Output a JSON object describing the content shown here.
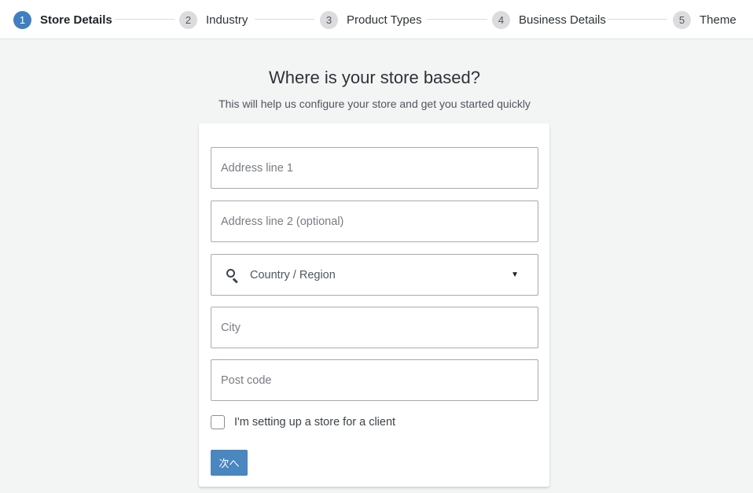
{
  "stepper": {
    "steps": [
      {
        "number": "1",
        "label": "Store Details",
        "active": true
      },
      {
        "number": "2",
        "label": "Industry",
        "active": false
      },
      {
        "number": "3",
        "label": "Product Types",
        "active": false
      },
      {
        "number": "4",
        "label": "Business Details",
        "active": false
      },
      {
        "number": "5",
        "label": "Theme",
        "active": false
      }
    ]
  },
  "header": {
    "title": "Where is your store based?",
    "subtitle": "This will help us configure your store and get you started quickly"
  },
  "form": {
    "address1": {
      "placeholder": "Address line 1",
      "value": ""
    },
    "address2": {
      "placeholder": "Address line 2 (optional)",
      "value": ""
    },
    "country": {
      "label": "Country / Region",
      "icon": "search-icon"
    },
    "city": {
      "placeholder": "City",
      "value": ""
    },
    "postcode": {
      "placeholder": "Post code",
      "value": ""
    },
    "client_checkbox": {
      "label": "I'm setting up a store for a client",
      "checked": false
    },
    "next_button": "次へ"
  },
  "colors": {
    "accent": "#3f7fc1",
    "button": "#4a86c0",
    "background": "#f3f4f4"
  }
}
